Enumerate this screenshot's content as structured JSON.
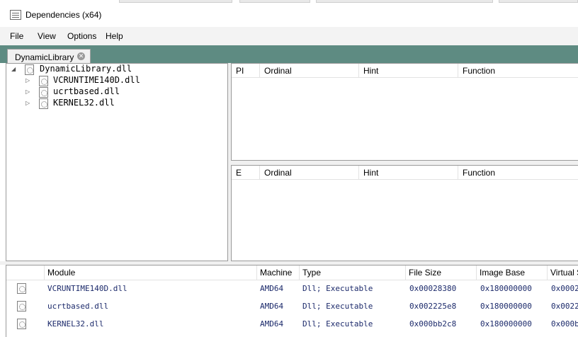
{
  "window": {
    "title": "Dependencies (x64)"
  },
  "menu": {
    "items": [
      "File",
      "View",
      "Options",
      "Help"
    ]
  },
  "tabs": [
    {
      "label": "DynamicLibrary",
      "close_glyph": "✕"
    }
  ],
  "tree": {
    "root": {
      "label": "DynamicLibrary.dll",
      "toggle": "◢",
      "icon": "dll-icon"
    },
    "children": [
      {
        "label": "VCRUNTIME140D.dll",
        "toggle": "▷",
        "icon": "dll-icon"
      },
      {
        "label": "ucrtbased.dll",
        "toggle": "▷",
        "icon": "dll-icon"
      },
      {
        "label": "KERNEL32.dll",
        "toggle": "▷",
        "icon": "dll-icon"
      }
    ]
  },
  "imports_grid": {
    "columns": [
      "PI",
      "Ordinal",
      "Hint",
      "Function"
    ]
  },
  "exports_grid": {
    "columns": [
      "E",
      "Ordinal",
      "Hint",
      "Function"
    ]
  },
  "modules": {
    "columns": [
      "",
      "Module",
      "Machine",
      "Type",
      "File Size",
      "Image Base",
      "Virtual S"
    ],
    "rows": [
      {
        "module": "VCRUNTIME140D.dll",
        "machine": "AMD64",
        "type": "Dll; Executable",
        "file_size": "0x00028380",
        "image_base": "0x180000000",
        "virtual_size": "0x0002"
      },
      {
        "module": "ucrtbased.dll",
        "machine": "AMD64",
        "type": "Dll; Executable",
        "file_size": "0x002225e8",
        "image_base": "0x180000000",
        "virtual_size": "0x0022"
      },
      {
        "module": "KERNEL32.dll",
        "machine": "AMD64",
        "type": "Dll; Executable",
        "file_size": "0x000bb2c8",
        "image_base": "0x180000000",
        "virtual_size": "0x000b"
      }
    ]
  },
  "colors": {
    "tab_band": "#5e8b82",
    "text_mono": "#1c2a6b"
  }
}
